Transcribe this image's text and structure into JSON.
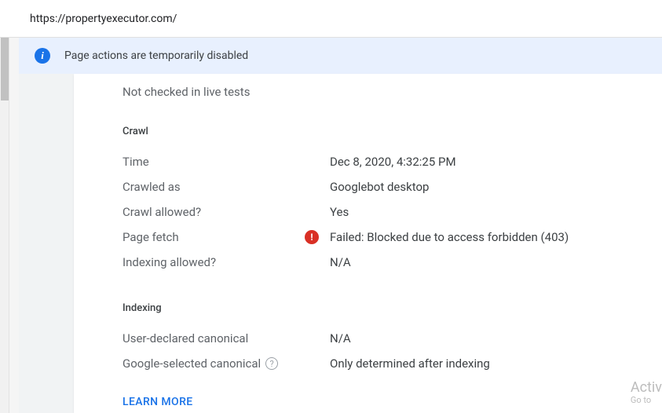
{
  "url": "https://propertyexecutor.com/",
  "notice": "Page actions are temporarily disabled",
  "not_checked": "Not checked in live tests",
  "sections": {
    "crawl": {
      "title": "Crawl",
      "rows": {
        "time": {
          "label": "Time",
          "value": "Dec 8, 2020, 4:32:25 PM"
        },
        "crawled_as": {
          "label": "Crawled as",
          "value": "Googlebot desktop"
        },
        "allowed": {
          "label": "Crawl allowed?",
          "value": "Yes"
        },
        "fetch": {
          "label": "Page fetch",
          "value": "Failed: Blocked due to access forbidden (403)",
          "error": true
        },
        "index_ok": {
          "label": "Indexing allowed?",
          "value": "N/A"
        }
      }
    },
    "indexing": {
      "title": "Indexing",
      "rows": {
        "user_canon": {
          "label": "User-declared canonical",
          "value": "N/A"
        },
        "google_canon": {
          "label": "Google-selected canonical",
          "value": "Only determined after indexing",
          "help": true
        }
      }
    }
  },
  "learn_more": "LEARN MORE",
  "watermark": {
    "line1": "Activ",
    "line2": "Go to"
  }
}
